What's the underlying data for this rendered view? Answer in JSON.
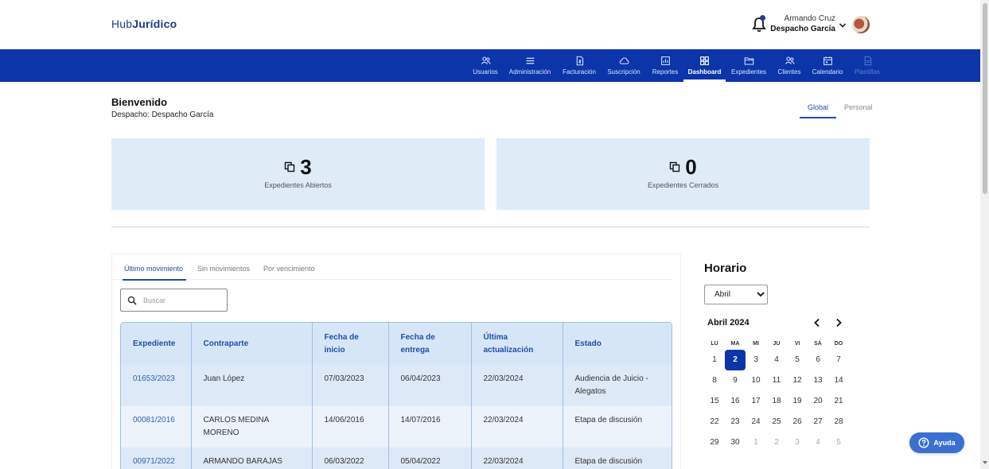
{
  "header": {
    "logo_light": "Hub",
    "logo_bold": "Jurídico",
    "user_name": "Armando Cruz",
    "user_org": "Despacho García"
  },
  "nav": {
    "items": [
      {
        "label": "Usuarios",
        "icon": "users-icon"
      },
      {
        "label": "Administración",
        "icon": "menu-icon"
      },
      {
        "label": "Facturación",
        "icon": "invoice-icon"
      },
      {
        "label": "Suscripción",
        "icon": "cloud-icon"
      },
      {
        "label": "Reportes",
        "icon": "chart-icon"
      },
      {
        "label": "Dashboard",
        "icon": "grid-icon"
      },
      {
        "label": "Expedientes",
        "icon": "folder-icon"
      },
      {
        "label": "Clientes",
        "icon": "clients-icon"
      },
      {
        "label": "Calendario",
        "icon": "calendar-icon"
      },
      {
        "label": "Plantillas",
        "icon": "document-icon"
      }
    ],
    "active": "Dashboard",
    "disabled": "Plantillas"
  },
  "welcome": {
    "title": "Bienvenido",
    "subtitle": "Despacho: Despacho García"
  },
  "scope_tabs": [
    "Global",
    "Personal"
  ],
  "stats": {
    "open_value": "3",
    "open_label": "Expedientes Abiertos",
    "closed_value": "0",
    "closed_label": "Expedientes Cerrados"
  },
  "filter_tabs": [
    "Último movimiento",
    "Sin movimientos",
    "Por vencimiento"
  ],
  "search": {
    "placeholder": "Buscar"
  },
  "table": {
    "headers": [
      "Expediente",
      "Contraparte",
      "Fecha de inicio",
      "Fecha de entrega",
      "Última actualización",
      "Estado"
    ],
    "rows": [
      [
        "01653/2023",
        "Juan López",
        "07/03/2023",
        "06/04/2023",
        "22/03/2024",
        "Audiencia de Juicio - Alegatos"
      ],
      [
        "00081/2016",
        "CARLOS MEDINA MORENO",
        "14/06/2016",
        "14/07/2016",
        "22/03/2024",
        "Etapa de discusión"
      ],
      [
        "00971/2022",
        "ARMANDO BARAJAS",
        "06/03/2022",
        "05/04/2022",
        "22/03/2024",
        "Etapa de discusión"
      ]
    ]
  },
  "schedule": {
    "title": "Horario",
    "month_selected": "Abril",
    "calendar_title": "Abril 2024",
    "weekdays": [
      "LU",
      "MA",
      "MI",
      "JU",
      "VI",
      "SÁ",
      "DO"
    ],
    "weeks": [
      [
        "1",
        "2",
        "3",
        "4",
        "5",
        "6",
        "7"
      ],
      [
        "8",
        "9",
        "10",
        "11",
        "12",
        "13",
        "14"
      ],
      [
        "15",
        "16",
        "17",
        "18",
        "19",
        "20",
        "21"
      ],
      [
        "22",
        "23",
        "24",
        "25",
        "26",
        "27",
        "28"
      ],
      [
        "29",
        "30",
        "1",
        "2",
        "3",
        "4",
        "5"
      ]
    ],
    "today": "2"
  },
  "help": {
    "label": "Ayuda"
  },
  "colors": {
    "brand": "#0b35a8",
    "card": "#dfebf7",
    "link": "#2f63b8"
  }
}
